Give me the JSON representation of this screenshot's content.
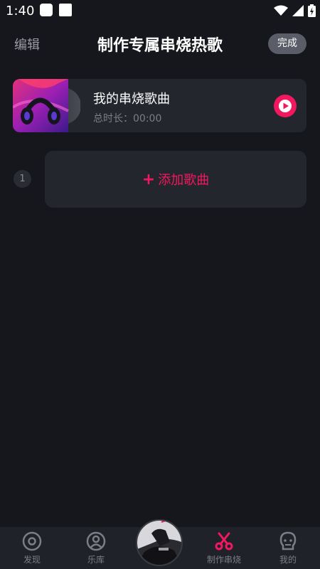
{
  "status_bar": {
    "time": "1:40",
    "icons": [
      "wifi-icon",
      "signal-icon",
      "battery-icon"
    ]
  },
  "header": {
    "edit_label": "编辑",
    "title": "制作专属串烧热歌",
    "done_label": "完成"
  },
  "playlist": {
    "name": "我的串烧歌曲",
    "duration": "总时长：00:00",
    "cover_icon": "headphones-cover-icon",
    "play_icon": "play-icon"
  },
  "song_slots": [
    {
      "index": "1",
      "add_label": "添加歌曲",
      "add_icon": "plus-icon"
    }
  ],
  "bottom_nav": {
    "items": [
      {
        "label": "发现",
        "icon": "discover-icon",
        "active": false
      },
      {
        "label": "乐库",
        "icon": "library-icon",
        "active": false
      },
      {
        "label": "",
        "icon": "now-playing-disc",
        "active": false
      },
      {
        "label": "制作串烧",
        "icon": "scissors-icon",
        "active": true
      },
      {
        "label": "我的",
        "icon": "profile-icon",
        "active": false
      }
    ]
  },
  "colors": {
    "background": "#16171c",
    "card": "#24262e",
    "accent": "#f2185f",
    "muted_text": "#7c7e87",
    "done_button": "#5a5d68"
  }
}
